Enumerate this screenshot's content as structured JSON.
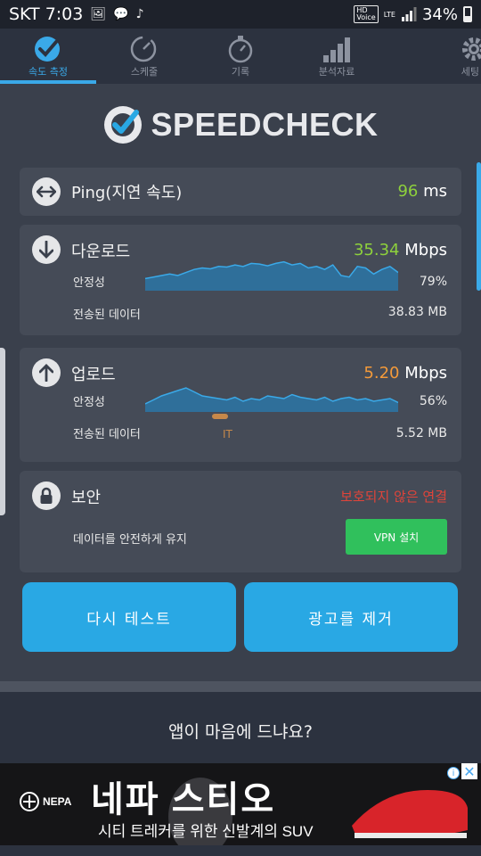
{
  "status_bar": {
    "carrier_time": "SKT 7:03",
    "battery_percent": "34%",
    "hd_label": "HD",
    "voice_label": "Voice",
    "network_label": "LTE"
  },
  "tabs": [
    {
      "label": "속도 측정",
      "icon": "speedometer-check-icon",
      "active": true
    },
    {
      "label": "스케줄",
      "icon": "scheduler-dial-icon",
      "active": false
    },
    {
      "label": "기록",
      "icon": "stopwatch-icon",
      "active": false
    },
    {
      "label": "분석자료",
      "icon": "bar-chart-icon",
      "active": false
    },
    {
      "label": "세팅",
      "icon": "gear-icon",
      "active": false
    }
  ],
  "brand": {
    "name": "SPEEDCHECK"
  },
  "ping": {
    "label": "Ping(지연 속도)",
    "value": "96",
    "unit": "ms"
  },
  "download": {
    "label": "다운로드",
    "speed": "35.34",
    "unit": "Mbps",
    "stability_label": "안정성",
    "stability_value": "79%",
    "data_label": "전송된 데이터",
    "data_value": "38.83 MB",
    "stability_fraction": 0.79
  },
  "upload": {
    "label": "업로드",
    "speed": "5.20",
    "unit": "Mbps",
    "stability_label": "안정성",
    "stability_value": "56%",
    "data_label": "전송된 데이터",
    "data_value": "5.52 MB",
    "stability_fraction": 0.56,
    "server_code": "IT"
  },
  "security": {
    "label": "보안",
    "status": "보호되지 않은 연결",
    "description": "데이터를 안전하게 유지",
    "vpn_button": "VPN 설치"
  },
  "buttons": {
    "retest": "다시 테스트",
    "remove_ads": "광고를 제거"
  },
  "rate_prompt": "앱이 마음에 드냐요?",
  "ad": {
    "brand": "NEPA",
    "headline": "네파 스티오",
    "subline": "시티 트레커를 위한 신발계의 SUV"
  },
  "colors": {
    "accent": "#29a8e4",
    "ping_green": "#8ed13c",
    "download_green": "#8ed13c",
    "upload_orange": "#f39a3a",
    "warning_red": "#e0443a",
    "vpn_green": "#30c05c"
  },
  "chart_data": [
    {
      "type": "area",
      "name": "download-stability-graph",
      "values": [
        0.4,
        0.45,
        0.5,
        0.55,
        0.5,
        0.6,
        0.7,
        0.75,
        0.72,
        0.8,
        0.78,
        0.85,
        0.8,
        0.9,
        0.88,
        0.82,
        0.9,
        0.95,
        0.85,
        0.9,
        0.75,
        0.8,
        0.7,
        0.85,
        0.5,
        0.45,
        0.8,
        0.75,
        0.55,
        0.7,
        0.8,
        0.6
      ]
    },
    {
      "type": "area",
      "name": "upload-stability-graph",
      "values": [
        0.3,
        0.45,
        0.6,
        0.7,
        0.8,
        0.9,
        0.75,
        0.6,
        0.55,
        0.5,
        0.45,
        0.55,
        0.4,
        0.5,
        0.45,
        0.6,
        0.55,
        0.5,
        0.65,
        0.55,
        0.5,
        0.45,
        0.55,
        0.4,
        0.5,
        0.55,
        0.45,
        0.5,
        0.4,
        0.45,
        0.5,
        0.35
      ]
    }
  ]
}
